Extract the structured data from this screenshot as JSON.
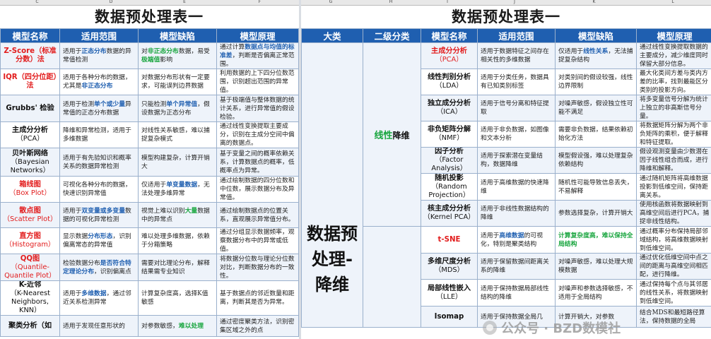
{
  "col_letters": [
    "C",
    "D",
    "E",
    "F",
    "G",
    "H",
    "I",
    "J",
    "K",
    "L"
  ],
  "left": {
    "title": "数据预处理表一",
    "headers": [
      "模型名称",
      "适用范围",
      "模型缺陷",
      "模型原理"
    ],
    "rows": [
      {
        "name": "Z-Score（标准分数）法",
        "red": true,
        "scope": [
          {
            "t": "适用于"
          },
          {
            "t": "正态分布",
            "c": "blu"
          },
          {
            "t": "数据的异常值检测"
          }
        ],
        "flaw": [
          {
            "t": "对"
          },
          {
            "t": "非正态分布",
            "c": "grn"
          },
          {
            "t": "数据，易受"
          },
          {
            "t": "极端值",
            "c": "grn"
          },
          {
            "t": "影响"
          }
        ],
        "principle": [
          {
            "t": "通过计算"
          },
          {
            "t": "数据点与均值的标准差",
            "c": "blu"
          },
          {
            "t": "，判断是否偏离正常范围。"
          }
        ]
      },
      {
        "name": "IQR（四分位距）法",
        "red": true,
        "scope": [
          {
            "t": "适用于各种分布的数据，尤其是"
          },
          {
            "t": "非正态分布",
            "c": "blu"
          }
        ],
        "flaw": [
          {
            "t": "对数据分布形状有一定要求，可能误判边界数据"
          }
        ],
        "principle": [
          {
            "t": "利用数据的上下四分位数范围，识别超出范围的异常值。"
          }
        ]
      },
      {
        "name": "Grubbs' 检验",
        "red": false,
        "scope": [
          {
            "t": "适用于检测"
          },
          {
            "t": "单个或少量",
            "c": "blu"
          },
          {
            "t": "异常值的正态分布数据"
          }
        ],
        "flaw": [
          {
            "t": "只能检测"
          },
          {
            "t": "单个异常值",
            "c": "blu"
          },
          {
            "t": "，假设数据为正态分布"
          }
        ],
        "principle": [
          {
            "t": "基于极端值与整体数据的统计关系，进行异常值的假设检验。"
          }
        ]
      },
      {
        "name": "主成分分析",
        "sub": "（PCA）",
        "red": false,
        "scope": [
          {
            "t": "降维和异常检测，适用于多维数据"
          }
        ],
        "flaw": [
          {
            "t": "对线性关系敏感，难以捕捉复杂模式"
          }
        ],
        "principle": [
          {
            "t": "通过线性变换提取主要成分，识别在主成分空间中偏离的数据点。"
          }
        ]
      },
      {
        "name": "贝叶斯网络",
        "sub": "（Bayesian Networks）",
        "red": false,
        "scope": [
          {
            "t": "适用于有先验知识和概率关系的数据异常检测"
          }
        ],
        "flaw": [
          {
            "t": "模型构建复杂，计算开销大"
          }
        ],
        "principle": [
          {
            "t": "基于变量之间的概率依赖关系，计算数据点的概率，低概率点为异常。"
          }
        ]
      },
      {
        "name": "箱线图",
        "sub": "（Box Plot）",
        "red": true,
        "scope": [
          {
            "t": "可视化各种分布的数据，快速识别异常值"
          }
        ],
        "flaw": [
          {
            "t": "仅适用于"
          },
          {
            "t": "单变量数据",
            "c": "blu"
          },
          {
            "t": "，无法处理多维异常"
          }
        ],
        "principle": [
          {
            "t": "通过绘制数据的四分位数和中位数，展示数据分布及异常值。"
          }
        ]
      },
      {
        "name": "散点图",
        "sub": "（Scatter Plot）",
        "red": true,
        "scope": [
          {
            "t": "适用于"
          },
          {
            "t": "双变量或多变量",
            "c": "blu"
          },
          {
            "t": "数据的可视化异常检测"
          }
        ],
        "flaw": [
          {
            "t": "视觉上难以识别"
          },
          {
            "t": "大量",
            "c": "grn"
          },
          {
            "t": "数据中的异常点"
          }
        ],
        "principle": [
          {
            "t": "通过绘制数据点的位置关系，直观展示异常值分布。"
          }
        ]
      },
      {
        "name": "直方图",
        "sub": "（Histogram）",
        "red": true,
        "scope": [
          {
            "t": "显示数据"
          },
          {
            "t": "分布形态",
            "c": "blu"
          },
          {
            "t": "，识别偏离常态的异常值"
          }
        ],
        "flaw": [
          {
            "t": "难以处理多维数据，依赖于分箱策略"
          }
        ],
        "principle": [
          {
            "t": "通过分组显示数据频率，观察数据分布中的异常或低值。"
          }
        ]
      },
      {
        "name": "QQ图",
        "sub": "（Quantile-Quantile Plot）",
        "red": true,
        "scope": [
          {
            "t": "检验数据分布"
          },
          {
            "t": "是否符合特定理论分布",
            "c": "blu"
          },
          {
            "t": "，识别偏离点"
          }
        ],
        "flaw": [
          {
            "t": "需要对比理论分布，解释结果需专业知识"
          }
        ],
        "principle": [
          {
            "t": "将数据分位数与理论分位数对比，判断数据分布的一致性。"
          }
        ]
      },
      {
        "name": "K-近邻",
        "sub": "（K-Nearest Neighbors, KNN）",
        "red": false,
        "scope": [
          {
            "t": "适用于"
          },
          {
            "t": "多维数据",
            "c": "blu"
          },
          {
            "t": "，通过邻近关系检测异常"
          }
        ],
        "flaw": [
          {
            "t": "计算复杂度高，选择K值敏感"
          }
        ],
        "principle": [
          {
            "t": "基于数据点的邻近数量和距离，判断其是否为异常。"
          }
        ]
      },
      {
        "name": "聚类分析（如",
        "red": false,
        "scope": [
          {
            "t": "适用于发现任意形状的"
          }
        ],
        "flaw": [
          {
            "t": "对参数敏感，"
          },
          {
            "t": "难以处理",
            "c": "grn"
          }
        ],
        "principle": [
          {
            "t": "通过密度聚类方法，识别密集区域之外的点"
          }
        ]
      }
    ]
  },
  "right": {
    "title": "数据预处理表一",
    "headers": [
      "大类",
      "二级分类",
      "模型名称",
      "适用范围",
      "模型缺陷",
      "模型原理"
    ],
    "category": "数据预\n处理-\n降维",
    "subcategory_green": "线性",
    "subcategory_rest": "降维",
    "rows": [
      {
        "name": "主成分分析",
        "sub": "（PCA）",
        "red": true,
        "scope": [
          {
            "t": "适用于数据特征之间存在相关性的多维数据"
          }
        ],
        "flaw": [
          {
            "t": "仅适用于"
          },
          {
            "t": "线性关系",
            "c": "blu"
          },
          {
            "t": "，无法捕捉复杂结构"
          }
        ],
        "principle": [
          {
            "t": "通过线性变换提取数据的主要成分，减少维度同时保留大部分信息。"
          }
        ]
      },
      {
        "name": "线性判别分析",
        "sub": "（LDA）",
        "red": false,
        "scope": [
          {
            "t": "适用于分类任务，数据具有已知类别标签"
          }
        ],
        "flaw": [
          {
            "t": "对类别间的假设较强，线性边界限制"
          }
        ],
        "principle": [
          {
            "t": "最大化类间方差与类内方差的比率，找到最能区分类别的投影方向。"
          }
        ]
      },
      {
        "name": "独立成分分析",
        "sub": "（ICA）",
        "red": false,
        "scope": [
          {
            "t": "适用于信号分离和特征提取"
          }
        ],
        "flaw": [
          {
            "t": "对噪声敏感，假设独立性可能不满足"
          }
        ],
        "principle": [
          {
            "t": "将多变量信号分解为统计上独立的非高斯信号分量。"
          }
        ]
      },
      {
        "name": "非负矩阵分解",
        "sub": "（NMF）",
        "red": false,
        "scope": [
          {
            "t": "适用于非负数据，如图像和文本分析"
          }
        ],
        "flaw": [
          {
            "t": "需要非负数据，结果依赖初始化方法"
          }
        ],
        "principle": [
          {
            "t": "将数据矩阵分解为两个非负矩阵的乘积，便于解释和特征提取。"
          }
        ]
      },
      {
        "name": "因子分析",
        "sub": "（Factor Analysis）",
        "red": false,
        "scope": [
          {
            "t": "适用于探索潜在变量结构，数据降维"
          }
        ],
        "flaw": [
          {
            "t": "模型假设强，难以处理复杂依赖结构"
          }
        ],
        "principle": [
          {
            "t": "假设观测变量由少数潜在因子线性组合而成，进行降维和解释。"
          }
        ]
      },
      {
        "name": "随机投影",
        "sub": "（Random Projection）",
        "red": false,
        "scope": [
          {
            "t": "适用于高维数据的快速降维"
          }
        ],
        "flaw": [
          {
            "t": "随机性可能导致信息丢失，不易解释"
          }
        ],
        "principle": [
          {
            "t": "通过随机矩阵将高维数据投影到低维空间，保持距离关系。"
          }
        ]
      },
      {
        "name": "核主成分分析",
        "sub": "（Kernel PCA）",
        "red": false,
        "scope": [
          {
            "t": "适用于非线性数据结构的降维"
          }
        ],
        "flaw": [
          {
            "t": "参数选择复杂，计算开销大"
          }
        ],
        "principle": [
          {
            "t": "使用核函数将数据映射到高维空间后进行PCA，捕捉非线性结构。"
          }
        ]
      },
      {
        "name": "t-SNE",
        "red": true,
        "scope": [
          {
            "t": "适用于"
          },
          {
            "t": "高维数据",
            "c": "blu"
          },
          {
            "t": "的可视化，特别是聚类结构"
          }
        ],
        "flaw": [
          {
            "t": "计算复杂度高，难以保持全局结构",
            "c": "grn"
          }
        ],
        "principle": [
          {
            "t": "通过概率分布保持局部邻域结构，将高维数据映射到低维空间。"
          }
        ]
      },
      {
        "name": "多维尺度分析",
        "sub": "（MDS）",
        "red": false,
        "scope": [
          {
            "t": "适用于保留数据间距离关系的降维"
          }
        ],
        "flaw": [
          {
            "t": "对噪声敏感，难以处理大规模数据"
          }
        ],
        "principle": [
          {
            "t": "通过优化低维空间中点之间的距离与高维空间相匹配，进行降维。"
          }
        ]
      },
      {
        "name": "局部线性嵌入",
        "sub": "（LLE）",
        "red": false,
        "scope": [
          {
            "t": "适用于保持数据局部线性结构的降维"
          }
        ],
        "flaw": [
          {
            "t": "对噪声和参数选择敏感，不适用于全局结构"
          }
        ],
        "principle": [
          {
            "t": "通过保持每个点与其邻居的线性关系，将数据映射到低维空间。"
          }
        ]
      },
      {
        "name": "Isomap",
        "red": false,
        "scope": [
          {
            "t": "适用于保持数据全局几"
          }
        ],
        "flaw": [
          {
            "t": "计算开销大，对参数"
          }
        ],
        "principle": [
          {
            "t": "结合MDS和最短路径算法，保持数据的全局"
          }
        ]
      }
    ]
  },
  "watermark": "公众号 · BZD数模社"
}
